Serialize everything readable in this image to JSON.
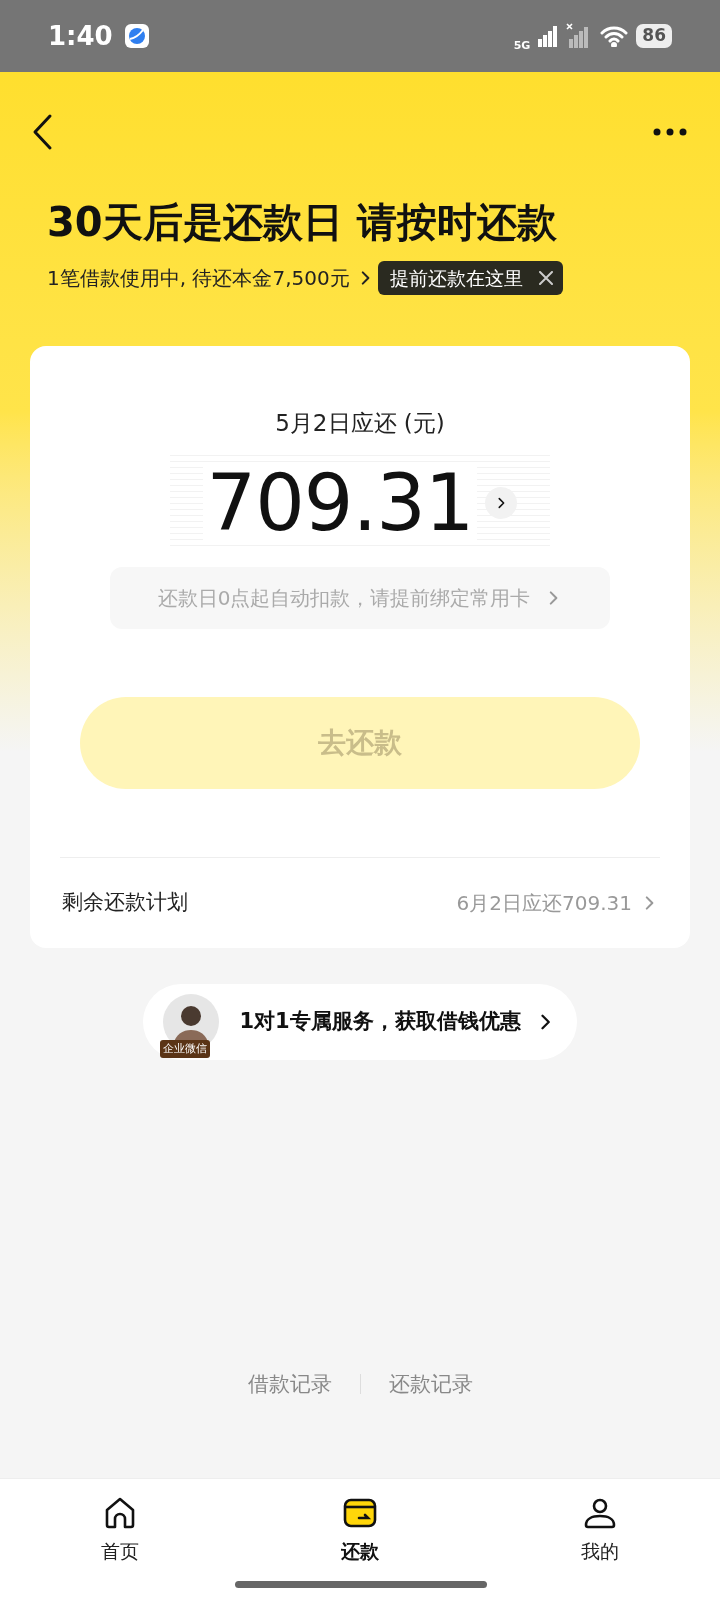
{
  "status_bar": {
    "time": "1:40",
    "network": "5G",
    "battery": "86"
  },
  "header": {
    "title": "30天后是还款日 请按时还款",
    "subtitle": "1笔借款使用中, 待还本金7,500元",
    "tooltip": {
      "text": "提前还款在这里"
    }
  },
  "card": {
    "due_label": "5月2日应还 (元)",
    "amount": "709.31",
    "notice": "还款日0点起自动扣款，请提前绑定常用卡",
    "pay_button": {
      "label": "去还款",
      "disabled": true
    },
    "plan": {
      "label": "剩余还款计划",
      "value": "6月2日应还709.31"
    }
  },
  "service": {
    "badge": "企业微信",
    "text": "1对1专属服务，获取借钱优惠"
  },
  "links": [
    "借款记录",
    "还款记录"
  ],
  "tabs": [
    {
      "kind": "home",
      "label": "首页",
      "selected": false
    },
    {
      "kind": "repay",
      "label": "还款",
      "selected": true
    },
    {
      "kind": "profile",
      "label": "我的",
      "selected": false
    }
  ]
}
